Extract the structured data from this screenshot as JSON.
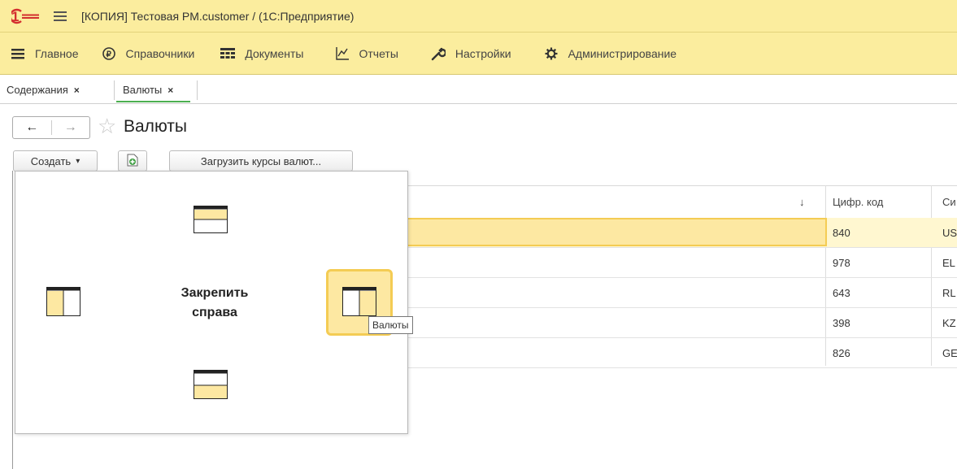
{
  "window": {
    "title": "[КОПИЯ] Тестовая PM.customer /  (1С:Предприятие)"
  },
  "menu": {
    "items": [
      {
        "label": "Главное",
        "icon": "burger-icon"
      },
      {
        "label": "Справочники",
        "icon": "ruble-icon"
      },
      {
        "label": "Документы",
        "icon": "table-icon"
      },
      {
        "label": "Отчеты",
        "icon": "chart-icon"
      },
      {
        "label": "Настройки",
        "icon": "wrench-icon"
      },
      {
        "label": "Администрирование",
        "icon": "gear-icon"
      }
    ]
  },
  "tabs": [
    {
      "label": "Содержания",
      "close": "×"
    },
    {
      "label": "Валюты",
      "close": "×",
      "active": true
    }
  ],
  "page": {
    "title": "Валюты",
    "back": "←",
    "forward": "→",
    "star": "☆"
  },
  "toolbar": {
    "create_label": "Создать",
    "create_caret": "▾",
    "load_rates_label": "Загрузить курсы валют..."
  },
  "grid": {
    "sort_indicator": "↓",
    "columns": [
      "Цифр. код",
      "Си"
    ],
    "rows": [
      {
        "code": "840",
        "sym": "US",
        "selected": true
      },
      {
        "code": "978",
        "sym": "EL"
      },
      {
        "code": "643",
        "sym": "RL"
      },
      {
        "code": "398",
        "sym": "KZ"
      },
      {
        "code": "826",
        "sym": "GE"
      }
    ]
  },
  "dock_popup": {
    "label_line1": "Закрепить",
    "label_line2": "справа",
    "tooltip": "Валюты"
  },
  "colors": {
    "header_bg": "#fbed9e",
    "selection": "#fde8a2",
    "selection_border": "#f4cc54",
    "tab_active": "#4caf50"
  }
}
